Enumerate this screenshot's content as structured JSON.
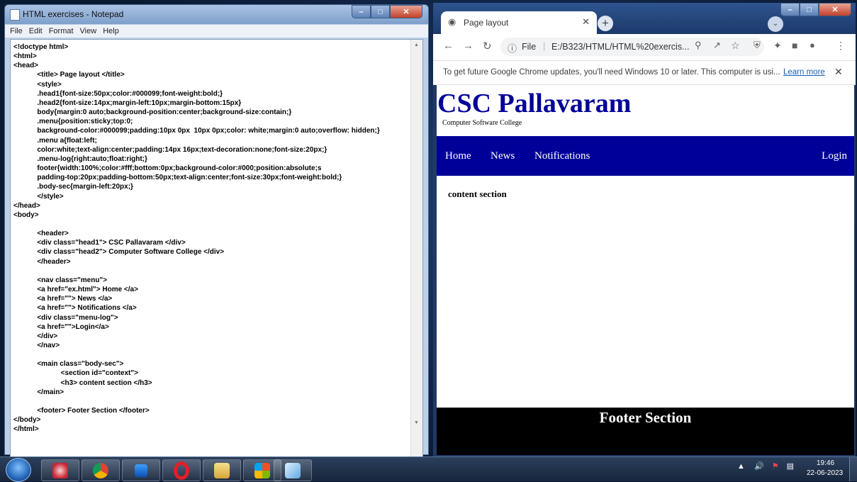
{
  "notepad": {
    "title": "HTML exercises - Notepad",
    "menu": [
      "File",
      "Edit",
      "Format",
      "View",
      "Help"
    ],
    "lines": [
      "<!doctype html>",
      "<html>",
      "<head>",
      "            <title> Page layout </title>",
      "            <style>",
      "            .head1{font-size:50px;color:#000099;font-weight:bold;}",
      "            .head2{font-size:14px;margin-left:10px;margin-bottom:15px}",
      "            body{margin:0 auto;background-position:center;background-size:contain;}",
      "            .menu{position:sticky;top:0;",
      "            background-color:#000099;padding:10px 0px  10px 0px;color: white;margin:0 auto;overflow: hidden;}",
      "            .menu a{float:left;",
      "            color:white;text-align:center;padding:14px 16px;text-decoration:none;font-size:20px;}",
      "            .menu-log{right:auto;float:right;}",
      "            footer{width:100%;color:#fff;bottom:0px;background-color:#000;position:absolute;s",
      "            padding-top:20px;padding-bottom:50px;text-align:center;font-size:30px;font-weight:bold;}",
      "            .body-sec{margin-left:20px;}",
      "            </style>",
      "</head>",
      "<body>",
      "",
      "            <header>",
      "            <div class=\"head1\"> CSC Pallavaram </div>",
      "            <div class=\"head2\"> Computer Software College </div>",
      "            </header>",
      "",
      "            <nav class=\"menu\">",
      "            <a href=\"ex.html\"> Home </a>",
      "            <a href=\"\"> News </a>",
      "            <a href=\"\"> Notifications </a>",
      "            <div class=\"menu-log\">",
      "            <a href=\"\">Login</a>",
      "            </div>",
      "            </nav>",
      "",
      "            <main class=\"body-sec\">",
      "                        <section id=\"context\">",
      "                        <h3> content section </h3>",
      "            </main>",
      "",
      "            <footer> Footer Section </footer>",
      "</body>",
      "</html>"
    ]
  },
  "chrome": {
    "tab_title": "Page layout",
    "address": {
      "scheme_label": "File",
      "url": "E:/B323/HTML/HTML%20exercis..."
    },
    "infobar": {
      "text": "To get future Google Chrome updates, you'll need Windows 10 or later. This computer is usi...",
      "link": "Learn more"
    },
    "page": {
      "head1": "CSC Pallavaram",
      "head2": "Computer Software College",
      "nav": [
        "Home",
        "News",
        "Notifications"
      ],
      "login": "Login",
      "content_heading": "content section",
      "footer": "Footer Section"
    }
  },
  "taskbar": {
    "time": "19:46",
    "date": "22-06-2023"
  },
  "colors": {
    "head1": "#000099",
    "nav_bg": "#000099",
    "footer_bg": "#000000"
  },
  "icons": [
    "start-orb-icon",
    "paint-icon",
    "chrome-icon",
    "media-icon",
    "opera-icon",
    "explorer-icon",
    "winlogo-icon",
    "notepad-icon"
  ]
}
